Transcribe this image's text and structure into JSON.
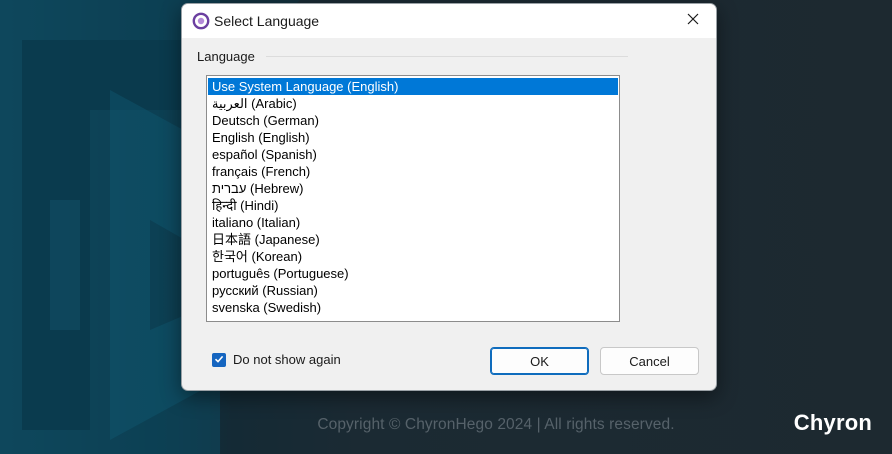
{
  "background": {
    "copyright": "Copyright © ChyronHego 2024  |  All rights reserved.",
    "brand": "Chyron"
  },
  "dialog": {
    "title": "Select Language",
    "group_label": "Language",
    "languages": [
      "Use System Language (English)",
      "العربية (Arabic)",
      "Deutsch (German)",
      "English (English)",
      "español (Spanish)",
      "français (French)",
      "עברית (Hebrew)",
      "हिन्दी (Hindi)",
      "italiano (Italian)",
      "日本語 (Japanese)",
      "한국어 (Korean)",
      "português (Portuguese)",
      "русский (Russian)",
      "svenska (Swedish)"
    ],
    "selected_index": 0,
    "checkbox_label": "Do not show again",
    "checkbox_checked": true,
    "ok_label": "OK",
    "cancel_label": "Cancel"
  },
  "colors": {
    "selection": "#0078d7",
    "checkbox": "#1565c0"
  },
  "icons": [
    "app-logo-icon",
    "close-icon",
    "checkmark-icon"
  ]
}
